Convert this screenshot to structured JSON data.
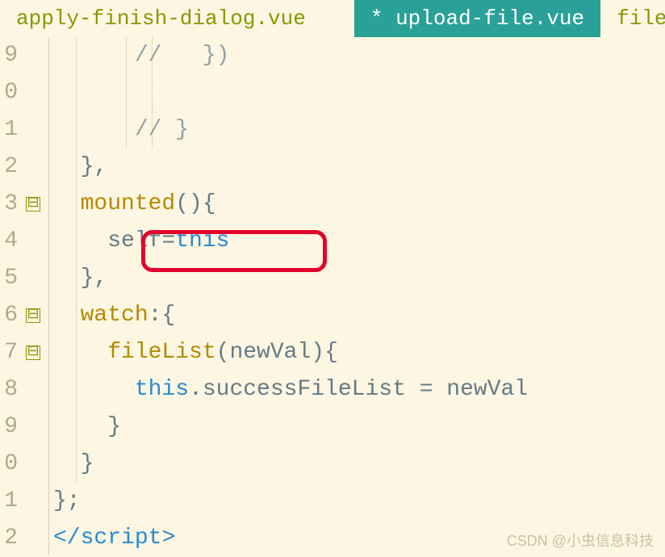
{
  "tabs": {
    "left": "apply-finish-dialog.vue",
    "active": "* upload-file.vue",
    "right": "file.js"
  },
  "lines": {
    "n0": "9",
    "n1": "0",
    "n2": "1",
    "n3": "2",
    "n4": "3",
    "n5": "4",
    "n6": "5",
    "n7": "6",
    "n8": "7",
    "n9": "8",
    "n10": "9",
    "n11": "0",
    "n12": "1",
    "n13": "2"
  },
  "fold": {
    "minus": "⊟"
  },
  "code": {
    "l0_comment": "//   })",
    "l2_comment": "// }",
    "l3": "},",
    "l4_mounted": "mounted",
    "l4_paren": "(){",
    "l5_self": "self",
    "l5_eq": "=",
    "l5_this": "this",
    "l6": "},",
    "l7_watch": "watch",
    "l7_colon": ":{",
    "l8_fn": "fileList",
    "l8_arg": "(newVal){",
    "l9_this": "this",
    "l9_rest": ".successFileList = newVal",
    "l10": "}",
    "l11": "}",
    "l12": "};",
    "l13_open": "</",
    "l13_tag": "script",
    "l13_close": ">"
  },
  "watermark": "CSDN @小虫信息科技"
}
